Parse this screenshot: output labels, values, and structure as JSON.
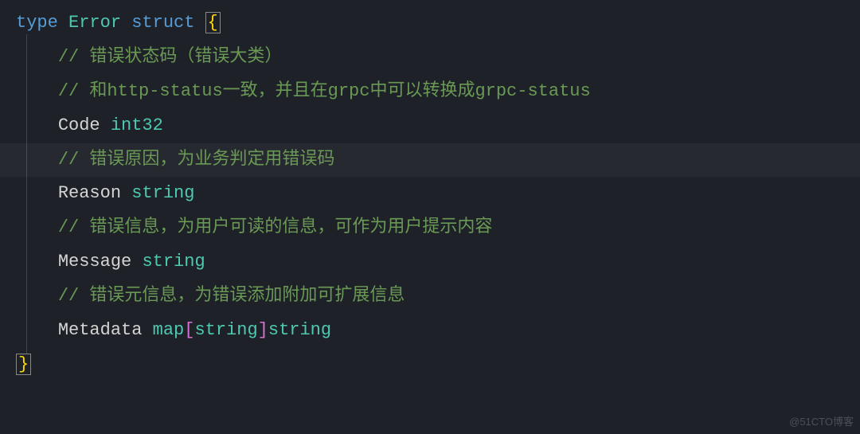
{
  "code": {
    "line1": {
      "kw_type": "type",
      "name": "Error",
      "kw_struct": "struct",
      "brace": "{"
    },
    "line2": {
      "comment": "// 错误状态码（错误大类）"
    },
    "line3": {
      "comment": "// 和http-status一致，并且在grpc中可以转换成grpc-status"
    },
    "line4": {
      "field": "Code",
      "type": "int32"
    },
    "line5": {
      "comment": "// 错误原因，为业务判定用错误码"
    },
    "line6": {
      "field": "Reason",
      "type": "string"
    },
    "line7": {
      "comment": "// 错误信息，为用户可读的信息，可作为用户提示内容"
    },
    "line8": {
      "field": "Message",
      "type": "string"
    },
    "line9": {
      "comment": "// 错误元信息，为错误添加附加可扩展信息"
    },
    "line10": {
      "field": "Metadata",
      "map_kw": "map",
      "key_type": "string",
      "value_type": "string",
      "lbracket": "[",
      "rbracket": "]"
    },
    "line11": {
      "brace": "}"
    }
  },
  "watermark": "@51CTO博客"
}
